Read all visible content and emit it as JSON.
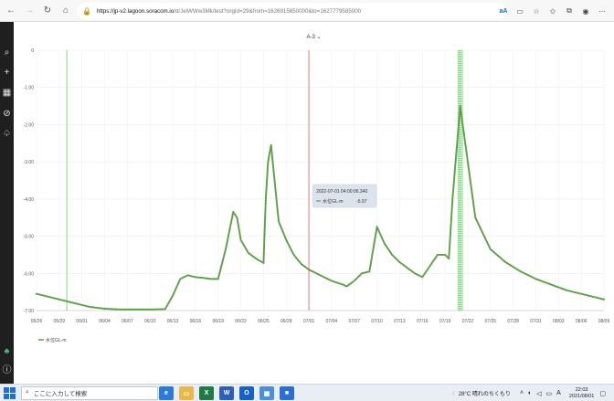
{
  "browser": {
    "url_domain": "https://jp-v2.lagoon.soracom.io",
    "url_path": "/d/JeiWWw3Mk/test?orgId=29&from=1626915850000&to=1627779585000",
    "tools": {
      "read_aloud": "aA"
    }
  },
  "chart_data": {
    "type": "line",
    "title": "A-3",
    "ylim": [
      -7.0,
      0
    ],
    "yticks": [
      "0",
      "-1.00",
      "-2.00",
      "-3.00",
      "-4.00",
      "-5.00",
      "-6.00",
      "-7.00"
    ],
    "xlim": [
      "05/26",
      "08/09"
    ],
    "xticks": [
      "05/26",
      "05/29",
      "06/01",
      "06/04",
      "06/07",
      "06/10",
      "06/13",
      "06/16",
      "06/19",
      "06/22",
      "06/25",
      "06/28",
      "07/01",
      "07/04",
      "07/07",
      "07/10",
      "07/13",
      "07/16",
      "07/19",
      "07/22",
      "07/25",
      "07/28",
      "07/31",
      "08/03",
      "08/06",
      "08/09"
    ],
    "grid": true,
    "legend_position": "bottom-left",
    "series": [
      {
        "name": "水位GL-m",
        "color": "#5e9e4a",
        "x_days": [
          0,
          3,
          5,
          7,
          9,
          11,
          13,
          15,
          17,
          18,
          19,
          20,
          21,
          22,
          23,
          24,
          25,
          26,
          26.5,
          27,
          28,
          29,
          30,
          30.3,
          30.6,
          31,
          32,
          33,
          34,
          35,
          36,
          37,
          38,
          39,
          40,
          40.5,
          41,
          42,
          43,
          44,
          45,
          46,
          47,
          48,
          50,
          51,
          53,
          54,
          54.5,
          55,
          56,
          57,
          58,
          60,
          62,
          64,
          66,
          68,
          70,
          72,
          74,
          75
        ],
        "y": [
          -6.55,
          -6.7,
          -6.8,
          -6.9,
          -6.95,
          -6.97,
          -6.97,
          -6.97,
          -6.96,
          -6.6,
          -6.15,
          -6.05,
          -6.1,
          -6.12,
          -6.15,
          -6.15,
          -5.35,
          -4.35,
          -4.5,
          -5.1,
          -5.45,
          -5.6,
          -5.72,
          -4.0,
          -3.0,
          -2.55,
          -4.6,
          -5.1,
          -5.5,
          -5.75,
          -5.9,
          -6.0,
          -6.1,
          -6.2,
          -6.27,
          -6.3,
          -6.35,
          -6.2,
          -6.0,
          -5.95,
          -4.75,
          -5.2,
          -5.5,
          -5.7,
          -6.0,
          -6.1,
          -5.5,
          -5.5,
          -5.6,
          -3.95,
          -1.5,
          -3.0,
          -4.5,
          -5.35,
          -5.7,
          -5.95,
          -6.15,
          -6.3,
          -6.45,
          -6.55,
          -6.65,
          -6.7
        ]
      }
    ],
    "markers": [
      {
        "type": "green-line",
        "x_day": 4
      },
      {
        "type": "red-line",
        "x_day": 36
      },
      {
        "type": "green-band",
        "x_day": 56
      }
    ],
    "tooltip": {
      "time": "2022-07-01 04:00:06.340",
      "label": "水位GL-m",
      "value": "-5.97"
    }
  },
  "taskbar": {
    "search_placeholder": "ここに入力して検索",
    "weather": "28°C 晴れのちくもり",
    "ime": "A",
    "time": "22:03",
    "date": "2021/08/01"
  }
}
